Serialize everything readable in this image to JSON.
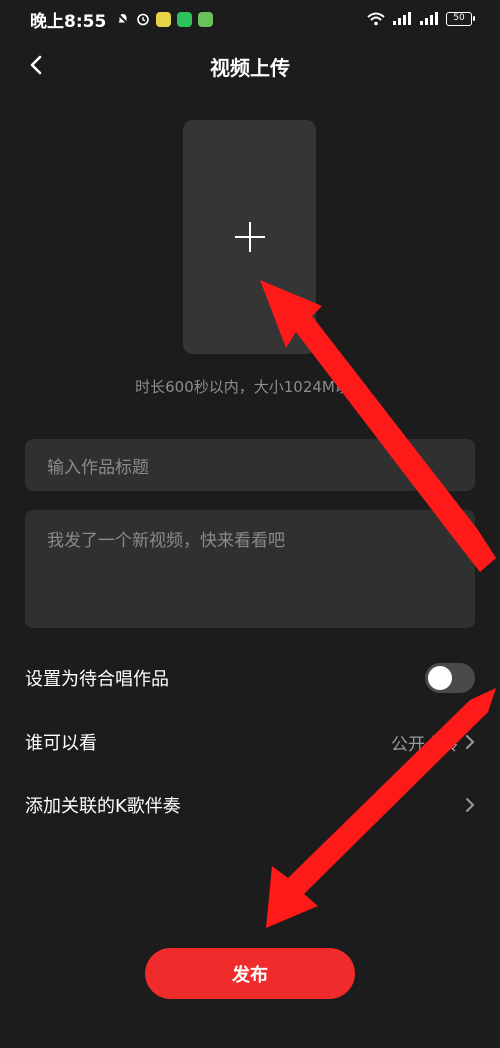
{
  "status_bar": {
    "time": "晚上8:55",
    "battery": "50"
  },
  "header": {
    "title": "视频上传",
    "back_icon": "chevron-left-icon"
  },
  "upload": {
    "icon": "plus-icon",
    "hint": "时长600秒以内，大小1024M以内"
  },
  "form": {
    "title_placeholder": "输入作品标题",
    "description_placeholder": "我发了一个新视频，快来看看吧"
  },
  "settings": {
    "chorus_label": "设置为待合唱作品",
    "chorus_enabled": false,
    "visibility_label": "谁可以看",
    "visibility_value": "公开上传",
    "accompaniment_label": "添加关联的K歌伴奏"
  },
  "publish_label": "发布",
  "colors": {
    "background": "#1c1c1d",
    "accent": "#f02b2b",
    "field": "#303031"
  }
}
